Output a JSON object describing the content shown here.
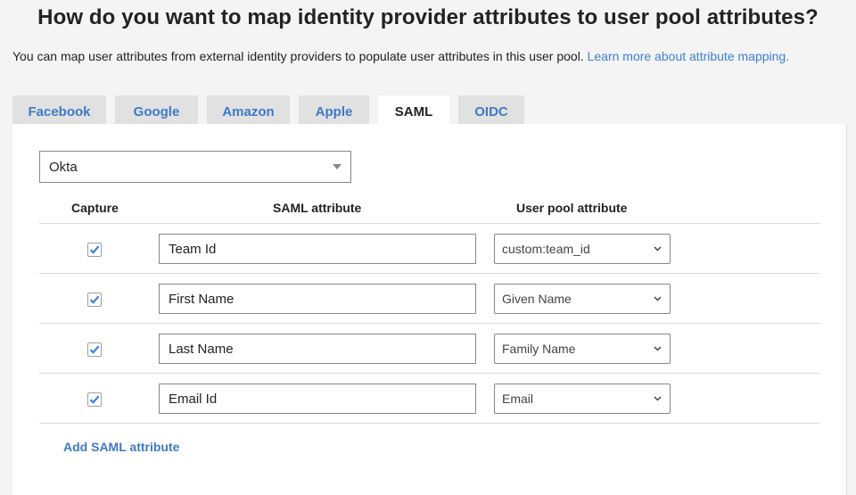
{
  "page": {
    "title": "How do you want to map identity provider attributes to user pool attributes?",
    "intro_text": "You can map user attributes from external identity providers to populate user attributes in this user pool. ",
    "intro_link": "Learn more about attribute mapping."
  },
  "tabs": [
    {
      "label": "Facebook",
      "active": false
    },
    {
      "label": "Google",
      "active": false
    },
    {
      "label": "Amazon",
      "active": false
    },
    {
      "label": "Apple",
      "active": false
    },
    {
      "label": "SAML",
      "active": true
    },
    {
      "label": "OIDC",
      "active": false
    }
  ],
  "provider_select": {
    "value": "Okta",
    "icon": "caret-down-icon"
  },
  "table": {
    "headers": {
      "capture": "Capture",
      "saml": "SAML attribute",
      "pool": "User pool attribute"
    },
    "rows": [
      {
        "capture": true,
        "saml_attribute": "Team Id",
        "pool_attribute": "custom:team_id"
      },
      {
        "capture": true,
        "saml_attribute": "First Name",
        "pool_attribute": "Given Name"
      },
      {
        "capture": true,
        "saml_attribute": "Last Name",
        "pool_attribute": "Family Name"
      },
      {
        "capture": true,
        "saml_attribute": "Email Id",
        "pool_attribute": "Email"
      }
    ]
  },
  "add_link": "Add SAML attribute",
  "colors": {
    "accent": "#3e79c8",
    "checkmark": "#3f7fd6",
    "panel_bg": "#ffffff",
    "page_bg": "#f3f4f3",
    "tab_bg": "#e1e1e1"
  }
}
